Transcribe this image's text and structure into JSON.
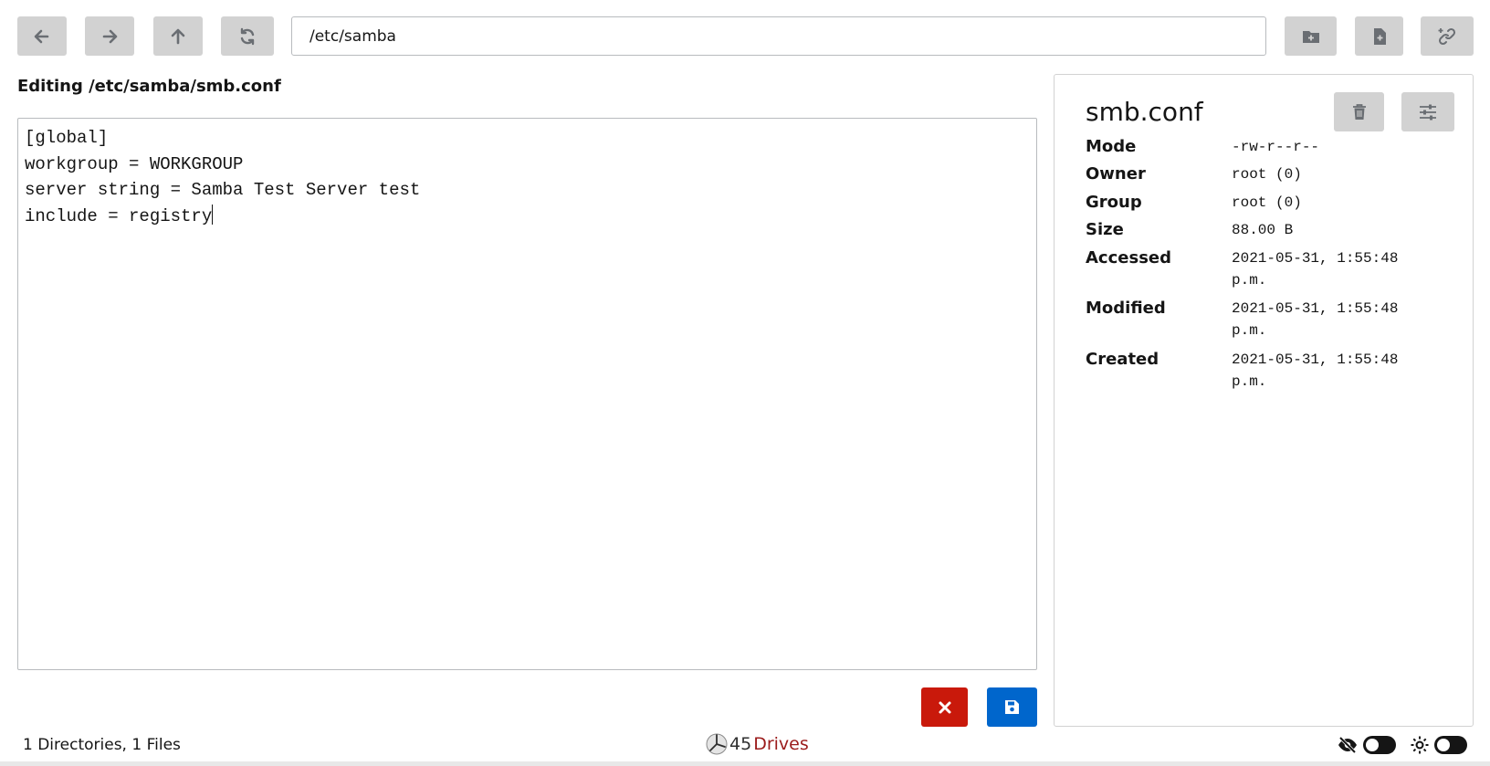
{
  "toolbar": {
    "path": "/etc/samba",
    "icons": [
      "arrow-left-icon",
      "arrow-right-icon",
      "arrow-up-icon",
      "refresh-icon",
      "folder-plus-icon",
      "file-plus-icon",
      "link-plus-icon"
    ]
  },
  "editor": {
    "title": "Editing /etc/samba/smb.conf",
    "content": "[global]\nworkgroup = WORKGROUP\nserver string = Samba Test Server test\ninclude = registry"
  },
  "actions": {
    "cancel_icon": "close-icon",
    "save_icon": "save-icon"
  },
  "properties": {
    "file_name": "smb.conf",
    "rows": [
      {
        "label": "Mode",
        "value": "-rw-r--r--"
      },
      {
        "label": "Owner",
        "value": "root (0)"
      },
      {
        "label": "Group",
        "value": "root (0)"
      },
      {
        "label": "Size",
        "value": "88.00 B"
      },
      {
        "label": "Accessed",
        "value": "2021-05-31, 1:55:48 p.m."
      },
      {
        "label": "Modified",
        "value": "2021-05-31, 1:55:48 p.m."
      },
      {
        "label": "Created",
        "value": "2021-05-31, 1:55:48 p.m."
      }
    ]
  },
  "footer": {
    "status": "1 Directories, 1 Files",
    "brand_number": "45",
    "brand_name": "Drives",
    "hidden_files_toggle": false,
    "theme_toggle": false
  },
  "colors": {
    "accent_blue": "#0066cc",
    "danger_red": "#c9190b",
    "brand_red": "#9b1c1c",
    "button_gray": "#d2d2d2"
  }
}
